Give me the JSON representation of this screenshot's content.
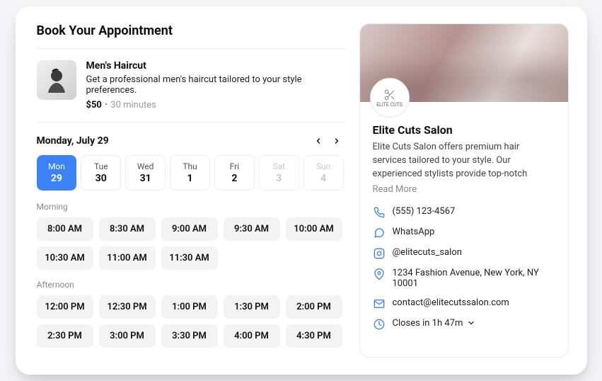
{
  "header": {
    "title": "Book Your Appointment"
  },
  "service": {
    "name": "Men's Haircut",
    "description": "Get a professional men's haircut tailored to your style preferences.",
    "price": "$50",
    "separator": "•",
    "duration": "30 minutes"
  },
  "calendar": {
    "selected_label": "Monday, July 29",
    "days": [
      {
        "dow": "Mon",
        "num": "29",
        "state": "selected"
      },
      {
        "dow": "Tue",
        "num": "30",
        "state": "normal"
      },
      {
        "dow": "Wed",
        "num": "31",
        "state": "normal"
      },
      {
        "dow": "Thu",
        "num": "1",
        "state": "normal"
      },
      {
        "dow": "Fri",
        "num": "2",
        "state": "normal"
      },
      {
        "dow": "Sat",
        "num": "3",
        "state": "disabled"
      },
      {
        "dow": "Sun",
        "num": "4",
        "state": "disabled"
      }
    ]
  },
  "slots": {
    "morning_label": "Morning",
    "morning": [
      "8:00 AM",
      "8:30 AM",
      "9:00 AM",
      "9:30 AM",
      "10:00 AM",
      "10:30 AM",
      "11:00 AM",
      "11:30 AM"
    ],
    "afternoon_label": "Afternoon",
    "afternoon": [
      "12:00 PM",
      "12:30 PM",
      "1:00 PM",
      "1:30 PM",
      "2:00 PM",
      "2:30 PM",
      "3:00 PM",
      "3:30 PM",
      "4:00 PM",
      "4:30 PM"
    ]
  },
  "business": {
    "logo_text": "ELITE CUTS",
    "name": "Elite Cuts Salon",
    "description": "Elite Cuts Salon offers premium hair services tailored to your style. Our experienced stylists provide top-notch",
    "read_more": "Read More",
    "phone": "(555) 123-4567",
    "whatsapp": "WhatsApp",
    "instagram": "@elitecuts_salon",
    "address": "1234 Fashion Avenue, New York, NY 10001",
    "email": "contact@elitecutssalon.com",
    "hours": "Closes in 1h 47m"
  }
}
